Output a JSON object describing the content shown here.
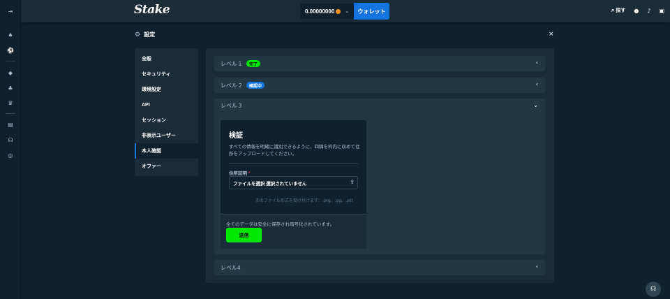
{
  "rail": {
    "icons": [
      "collapse-icon",
      "casino-icon",
      "sports-icon",
      "promotions-icon",
      "affiliate-icon",
      "vip-icon",
      "blog-icon",
      "support-icon",
      "language-icon"
    ]
  },
  "topbar": {
    "logo": "Stake",
    "balance": "0.00000000",
    "wallet_label": "ウォレット",
    "search_label": "探す"
  },
  "modal": {
    "title": "設定",
    "close": "×"
  },
  "nav": {
    "items": [
      {
        "label": "全般"
      },
      {
        "label": "セキュリティ"
      },
      {
        "label": "環境設定"
      },
      {
        "label": "API"
      },
      {
        "label": "セッション"
      },
      {
        "label": "非表示ユーザー"
      },
      {
        "label": "本人確認"
      },
      {
        "label": "オファー"
      }
    ],
    "active_index": 6
  },
  "levels": [
    {
      "label": "レベル１",
      "badge": "完了",
      "status": "complete"
    },
    {
      "label": "レベル２",
      "badge": "確認中",
      "status": "review"
    },
    {
      "label": "レベル３",
      "badge": "",
      "status": "open"
    },
    {
      "label": "レベル4",
      "badge": "",
      "status": "locked"
    }
  ],
  "verification": {
    "title": "検証",
    "description": "すべての情報を明確に識別できるように、四隅を枠内に収めて住所をアップロードしてください。",
    "field_label": "住所証明",
    "required_mark": "*",
    "file_value": "ファイルを選択 選択されていません",
    "formats": "次のファイル形式を受け付けます：.png、.jpg、.pdf",
    "secure_text": "全てのデータは安全に保存され暗号化されています。",
    "submit_label": "送信"
  },
  "colors": {
    "background": "#0f212e",
    "panel": "#1a2c38",
    "row": "#213743",
    "accent_blue": "#1475e1",
    "accent_green": "#00e701"
  }
}
